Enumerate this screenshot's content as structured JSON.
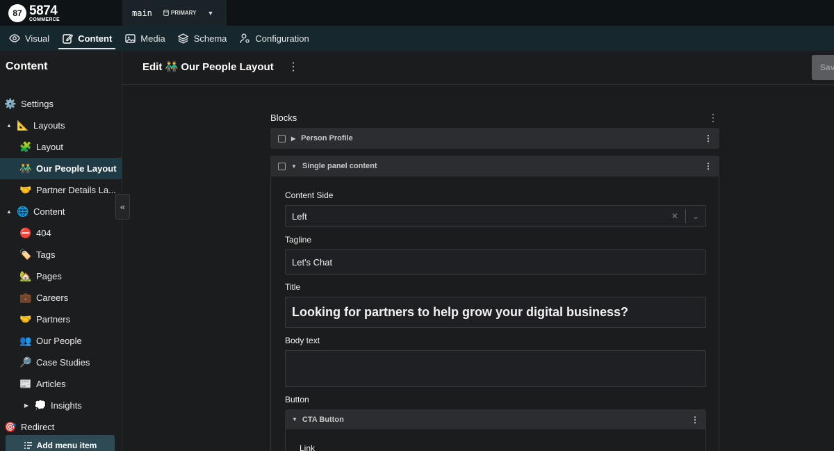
{
  "topbar": {
    "logo_mark": "87",
    "logo_number": "5874",
    "logo_sub": "COMMERCE",
    "branch": "main",
    "environment": "PRIMARY"
  },
  "nav": {
    "tabs": [
      {
        "label": "Visual",
        "icon": "eye-icon"
      },
      {
        "label": "Content",
        "icon": "edit-icon",
        "active": true
      },
      {
        "label": "Media",
        "icon": "image-icon"
      },
      {
        "label": "Schema",
        "icon": "layers-icon"
      },
      {
        "label": "Configuration",
        "icon": "config-icon"
      }
    ]
  },
  "sidebar": {
    "title": "Content",
    "items": [
      {
        "label": "Settings",
        "emoji": "⚙️"
      },
      {
        "label": "Layouts",
        "emoji": "📐"
      },
      {
        "label": "Layout",
        "emoji": "🧩"
      },
      {
        "label": "Our People Layout",
        "emoji": "👬"
      },
      {
        "label": "Partner Details La...",
        "emoji": "🤝"
      },
      {
        "label": "Content",
        "emoji": "🌐"
      },
      {
        "label": "404",
        "emoji": "⛔"
      },
      {
        "label": "Tags",
        "emoji": "🏷️"
      },
      {
        "label": "Pages",
        "emoji": "🏡"
      },
      {
        "label": "Careers",
        "emoji": "💼"
      },
      {
        "label": "Partners",
        "emoji": "🤝"
      },
      {
        "label": "Our People",
        "emoji": "👥"
      },
      {
        "label": "Case Studies",
        "emoji": "🔎"
      },
      {
        "label": "Articles",
        "emoji": "📰"
      },
      {
        "label": "Insights",
        "emoji": "💭"
      },
      {
        "label": "Redirect",
        "emoji": "🎯"
      }
    ],
    "add_menu_item": "Add menu item"
  },
  "header": {
    "title": "Edit 👬 Our People Layout",
    "save_label": "Save"
  },
  "editor": {
    "blocks_label": "Blocks",
    "blocks": [
      {
        "title": "Person Profile",
        "expanded": false
      },
      {
        "title": "Single panel content",
        "expanded": true
      }
    ],
    "fields": {
      "content_side_label": "Content Side",
      "content_side_value": "Left",
      "tagline_label": "Tagline",
      "tagline_value": "Let's Chat",
      "title_label": "Title",
      "title_value": "Looking for partners to help grow your digital business?",
      "body_label": "Body text",
      "body_value": "",
      "button_label": "Button",
      "button_block_title": "CTA Button",
      "link_label": "Link"
    }
  }
}
